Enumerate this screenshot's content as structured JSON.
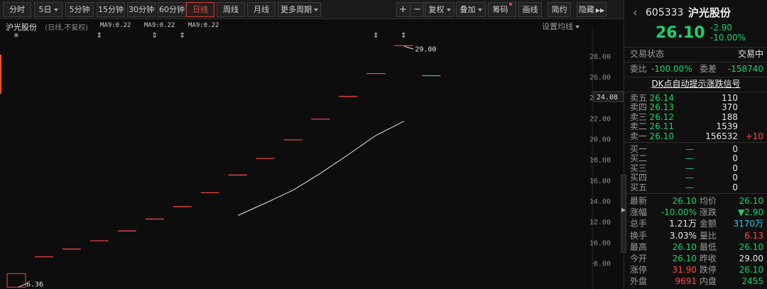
{
  "toolbar": {
    "periods": [
      "分时",
      "5日",
      "5分钟",
      "15分钟",
      "30分钟",
      "60分钟",
      "日线",
      "周线",
      "月线",
      "更多周期"
    ],
    "active_period": "日线",
    "zoom_in": "+",
    "zoom_out": "−",
    "fuquan": "复权",
    "diejia": "叠加",
    "chouma": "筹码",
    "huaxian": "画线",
    "jianyue": "简约",
    "yincang": "隐藏"
  },
  "chart": {
    "stock_name": "沪光股份",
    "mode": "(日线,不复权)",
    "ma_labels": [
      "MA9:0.22",
      "MA9:0.22",
      "MA9:0.22"
    ],
    "set_ma": "设置均线",
    "marker_symbol": "⇕",
    "star_symbol": "✳",
    "current_price_label": "24.08",
    "high_label": "29.00",
    "low_label": "6.36"
  },
  "chart_data": {
    "type": "line",
    "ylim": [
      7,
      29.5
    ],
    "yticks": [
      "28.00",
      "26.00",
      "24.00",
      "22.00",
      "20.00",
      "18.00",
      "16.00",
      "14.00",
      "12.00",
      "10.00",
      "8.00"
    ],
    "ytick_values": [
      28,
      26,
      24,
      22,
      20,
      18,
      16,
      14,
      12,
      10,
      8
    ],
    "limit_up_days": [
      6.36,
      8.6,
      9.35,
      10.15,
      11.1,
      12.25,
      13.45,
      14.8,
      16.5,
      18.1,
      19.9,
      21.9,
      24.1,
      26.3,
      29.0,
      26.1
    ],
    "ma_line": [
      12.6,
      13.8,
      15.05,
      16.7,
      18.5,
      20.35,
      21.7
    ],
    "ma_start_index": 8,
    "marker_days": [
      3,
      5,
      6,
      13,
      14
    ]
  },
  "panel": {
    "code": "605333",
    "name": "沪光股份",
    "price": "26.10",
    "change": "-2.90",
    "change_pct": "-10.00%",
    "trade_status_label": "交易状态",
    "trade_status_value": "交易中",
    "weibi_label": "委比",
    "weibi_value": "-100.00%",
    "weicha_label": "委差",
    "weicha_value": "-158740",
    "dk_link": "DK点自动提示涨跌信号",
    "asks": [
      {
        "label": "卖五",
        "price": "26.14",
        "vol": "110",
        "chg": ""
      },
      {
        "label": "卖四",
        "price": "26.13",
        "vol": "370",
        "chg": ""
      },
      {
        "label": "卖三",
        "price": "26.12",
        "vol": "188",
        "chg": ""
      },
      {
        "label": "卖二",
        "price": "26.11",
        "vol": "1539",
        "chg": ""
      },
      {
        "label": "卖一",
        "price": "26.10",
        "vol": "156532",
        "chg": "+10"
      }
    ],
    "bids": [
      {
        "label": "买一",
        "price": "—",
        "vol": "0"
      },
      {
        "label": "买二",
        "price": "—",
        "vol": "0"
      },
      {
        "label": "买三",
        "price": "—",
        "vol": "0"
      },
      {
        "label": "买四",
        "price": "—",
        "vol": "0"
      },
      {
        "label": "买五",
        "price": "—",
        "vol": "0"
      }
    ],
    "stats": [
      {
        "l1": "最新",
        "v1": "26.10",
        "c1": "g",
        "l2": "均价",
        "v2": "26.10",
        "c2": "g"
      },
      {
        "l1": "涨幅",
        "v1": "-10.00%",
        "c1": "g",
        "l2": "涨跌",
        "v2": "▼2.90",
        "c2": "g"
      },
      {
        "l1": "总手",
        "v1": "1.21万",
        "c1": "w",
        "l2": "金额",
        "v2": "3170万",
        "c2": "c"
      },
      {
        "l1": "换手",
        "v1": "3.03%",
        "c1": "w",
        "l2": "量比",
        "v2": "6.13",
        "c2": "r"
      },
      {
        "l1": "最高",
        "v1": "26.10",
        "c1": "g",
        "l2": "最低",
        "v2": "26.10",
        "c2": "g"
      },
      {
        "l1": "今开",
        "v1": "26.10",
        "c1": "g",
        "l2": "昨收",
        "v2": "29.00",
        "c2": "w"
      },
      {
        "l1": "涨停",
        "v1": "31.90",
        "c1": "r",
        "l2": "跌停",
        "v2": "26.10",
        "c2": "g"
      },
      {
        "l1": "外盘",
        "v1": "9691",
        "c1": "r",
        "l2": "内盘",
        "v2": "2455",
        "c2": "g"
      }
    ]
  },
  "colors": {
    "up": "#ff4a4a",
    "down": "#19d46b",
    "cyan": "#2bc8e8",
    "bg": "#0d0d0d"
  }
}
